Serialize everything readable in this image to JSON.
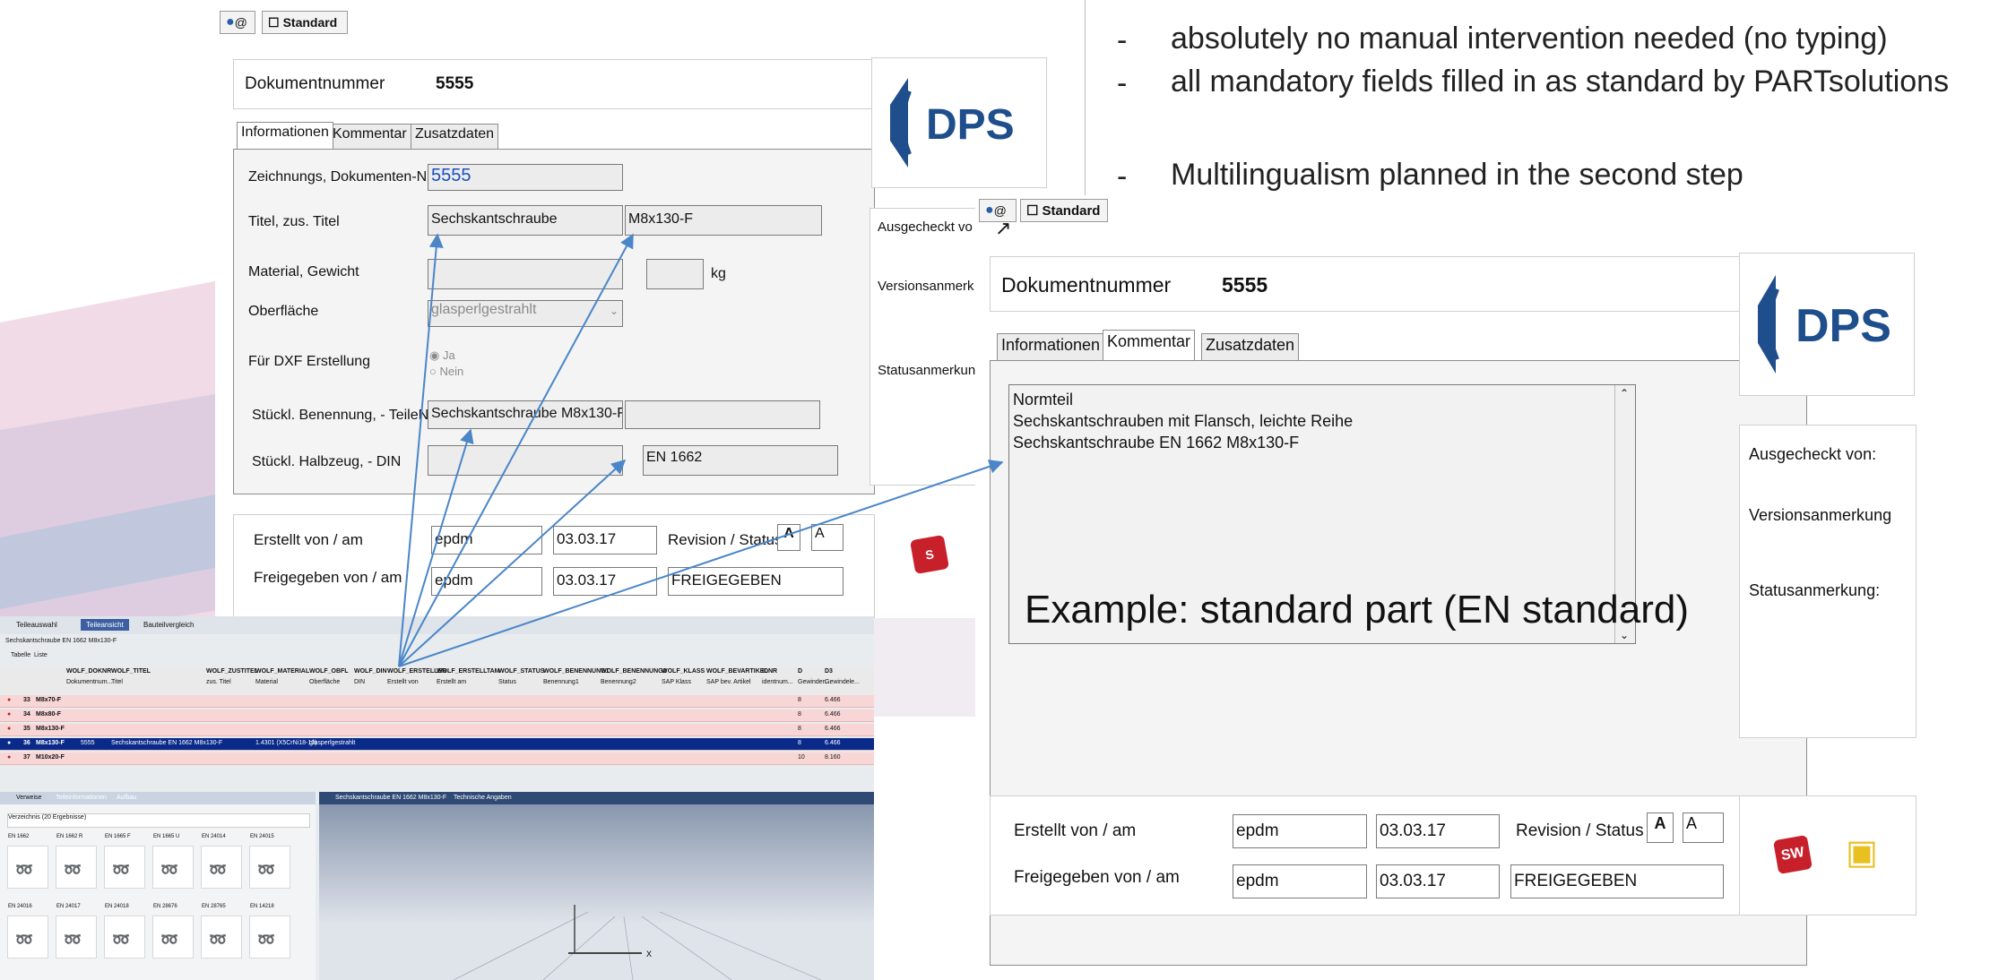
{
  "bullets": [
    "absolutely no manual intervention needed (no typing)",
    "all mandatory fields filled in as standard by PARTsolutions",
    "Multilingualism planned in the second step"
  ],
  "dash": "-",
  "caption": "Example: standard part (EN standard)",
  "dialog1": {
    "toolbar": {
      "at": "@",
      "standard": "Standard"
    },
    "doc_label": "Dokumentnummer",
    "doc_value": "5555",
    "tabs": [
      "Informationen",
      "Kommentar",
      "Zusatzdaten"
    ],
    "logo_text": "DPS",
    "fields": {
      "zeichnung_label": "Zeichnungs, Dokumenten-Nr.",
      "zeichnung_value": "5555",
      "titel_label": "Titel, zus. Titel",
      "titel_value": "Sechskantschraube",
      "zus_titel_value": "M8x130-F",
      "material_label": "Material, Gewicht",
      "gewicht_unit": "kg",
      "oberflaeche_label": "Oberfläche",
      "oberflaeche_value": "glasperlgestrahlt",
      "dxf_label": "Für DXF Erstellung",
      "dxf_ja": "Ja",
      "dxf_nein": "Nein",
      "stueckl_ben_label": "Stückl. Benennung, - TeileNr",
      "stueckl_ben_value": "Sechskantschraube M8x130-F",
      "halbzeug_label": "Stückl. Halbzeug, - DIN",
      "din_value": "EN 1662"
    },
    "side": {
      "ausgecheckt": "Ausgecheckt vo",
      "versions": "Versionsanmerk",
      "status": "Statusanmerkun"
    },
    "bottom": {
      "erstellt_label": "Erstellt von / am",
      "erstellt_von": "epdm",
      "erstellt_am": "03.03.17",
      "revision_label": "Revision / Status",
      "rev_a1": "A",
      "rev_a2": "A",
      "freigegeben_label": "Freigegeben von / am",
      "freig_von": "epdm",
      "freig_am": "03.03.17",
      "status_value": "FREIGEGEBEN"
    }
  },
  "dialog2": {
    "toolbar": {
      "at": "@",
      "standard": "Standard"
    },
    "doc_label": "Dokumentnummer",
    "doc_value": "5555",
    "tabs": [
      "Informationen",
      "Kommentar",
      "Zusatzdaten"
    ],
    "logo_text": "DPS",
    "comment_lines": [
      "Normteil",
      "Sechskantschrauben mit Flansch, leichte Reihe",
      "Sechskantschraube EN 1662 M8x130-F"
    ],
    "side": {
      "ausgecheckt": "Ausgecheckt von:",
      "versions": "Versionsanmerkung",
      "status": "Statusanmerkung:"
    },
    "bottom": {
      "erstellt_label": "Erstellt von / am",
      "erstellt_von": "epdm",
      "erstellt_am": "03.03.17",
      "revision_label": "Revision / Status",
      "rev_a1": "A",
      "rev_a2": "A",
      "freigegeben_label": "Freigegeben von / am",
      "freig_von": "epdm",
      "freig_am": "03.03.17",
      "status_value": "FREIGEGEBEN"
    },
    "sw_icon": "SW"
  },
  "table_shot": {
    "tabs": [
      "Teileauswahl",
      "Teileansicht",
      "Bauteilvergleich"
    ],
    "path": "Sechskantschraube EN 1662 M8x130-F",
    "subtabs": [
      "Tabelle",
      "Liste"
    ],
    "headers": [
      "WOLF_DOKNR",
      "WOLF_TITEL",
      "WOLF_ZUSTITEL",
      "WOLF_MATERIAL",
      "WOLF_OBFL",
      "WOLF_DIN",
      "WOLF_ERSTELLER",
      "WOLF_ERSTELLTAM",
      "WOLF_STATUS",
      "WOLF_BENENNUNG1",
      "WOLF_BENENNUNG2",
      "WOLF_KLASS",
      "WOLF_BEVARTIKEL",
      "IDNR",
      "D",
      "D3"
    ],
    "subheaders": [
      "Dokumentnum...",
      "Titel",
      "zus. Titel",
      "Material",
      "Oberfläche",
      "DIN",
      "Erstellt von",
      "Erstellt am",
      "Status",
      "Benennung1",
      "Benennung2",
      "SAP Klass",
      "SAP bev. Artikel",
      "identnum...",
      "Gewinden...",
      "Gewindele..."
    ],
    "rows": [
      {
        "n": "33",
        "name": "M8x70-F",
        "d": "8",
        "d3": "6.466"
      },
      {
        "n": "34",
        "name": "M8x80-F",
        "d": "8",
        "d3": "6.466"
      },
      {
        "n": "35",
        "name": "M8x130-F",
        "d": "8",
        "d3": "6.466"
      },
      {
        "n": "36",
        "name": "M8x130-F",
        "doknr": "5555",
        "titel": "Sechskantschraube EN 1662 M8x130-F",
        "material": "1.4301 (X5CrNi18-10)",
        "obfl": "glasperlgestrahlt",
        "d": "8",
        "d3": "6.466"
      },
      {
        "n": "37",
        "name": "M10x20-F",
        "d": "10",
        "d3": "8.160"
      }
    ],
    "panel_tabs": [
      "Verweise",
      "Teileinformationen",
      "Aufbau"
    ],
    "dropdown": "Verzeichnis (20 Ergebnisse)",
    "parts_row1": [
      "EN 1662",
      "EN 1662 R",
      "EN 1665 F",
      "EN 1665 U",
      "EN 24014",
      "EN 24015"
    ],
    "parts_row2": [
      "EN 24016",
      "EN 24017",
      "EN 24018",
      "EN 28676",
      "EN 28765",
      "EN 14218"
    ],
    "viewer_tabs": [
      "Sechskantschraube EN 1662 M8x130-F",
      "Technische Angaben"
    ],
    "axis_x": "X"
  },
  "colors": {
    "arrow": "#4a86c8",
    "logo_blue": "#1f4e8c",
    "selected_row": "#0a2a8a",
    "row_pink": "#f9d6d6"
  }
}
